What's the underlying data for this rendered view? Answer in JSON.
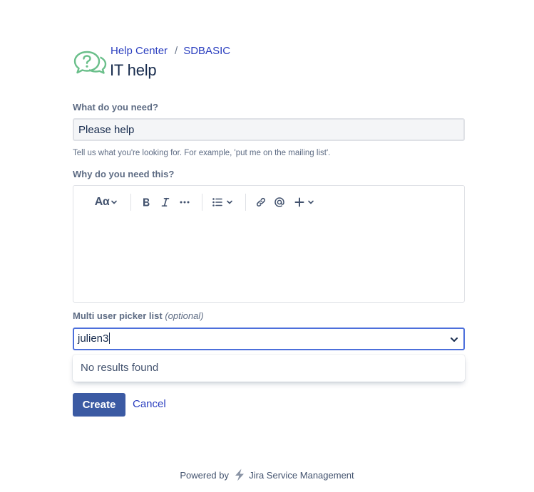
{
  "header": {
    "breadcrumb": [
      {
        "label": "Help Center"
      },
      {
        "label": "SDBASIC"
      }
    ],
    "separator": "/",
    "title": "IT help",
    "logo_icon": "chat-question-icon",
    "logo_color": "#6abf8a"
  },
  "form": {
    "summary": {
      "label": "What do you need?",
      "value": "Please help",
      "helper": "Tell us what you're looking for. For example, 'put me on the mailing list'."
    },
    "description": {
      "label": "Why do you need this?",
      "toolbar": {
        "text_style_label": "Aα",
        "icons": [
          "bold-icon",
          "italic-icon",
          "more-icon",
          "bullet-list-icon",
          "link-icon",
          "mention-icon",
          "plus-icon"
        ]
      },
      "value": ""
    },
    "user_picker": {
      "label": "Multi user picker list",
      "optional": "(optional)",
      "value": "julien3",
      "menu_message": "No results found"
    },
    "actions": {
      "create_label": "Create",
      "cancel_label": "Cancel"
    }
  },
  "footer": {
    "prefix": "Powered by",
    "product": "Jira Service Management"
  },
  "colors": {
    "link": "#2a3ebf",
    "primary_button": "#3b5aa3",
    "focus_border": "#4c6fdb"
  }
}
